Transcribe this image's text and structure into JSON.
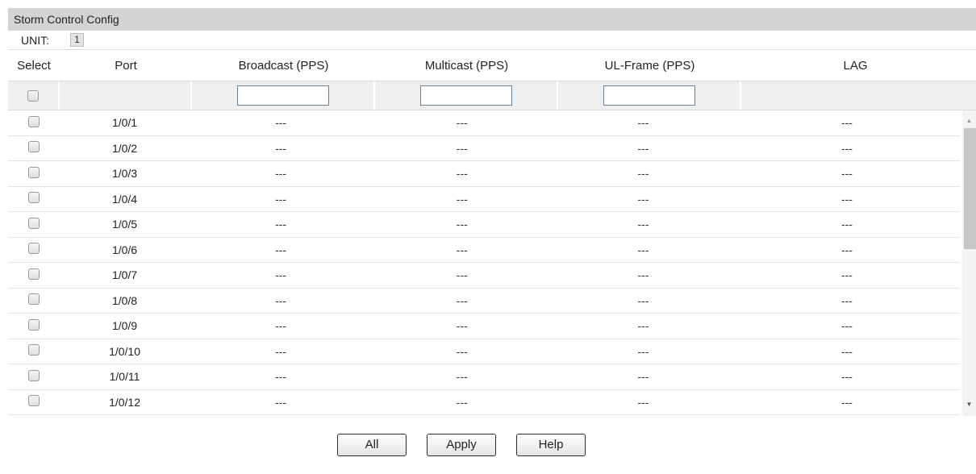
{
  "panel": {
    "title": "Storm Control Config",
    "unit_label": "UNIT:",
    "unit_value": "1"
  },
  "columns": {
    "select": "Select",
    "port": "Port",
    "broadcast": "Broadcast (PPS)",
    "multicast": "Multicast (PPS)",
    "ulframe": "UL-Frame (PPS)",
    "lag": "LAG"
  },
  "filter": {
    "broadcast_value": "",
    "multicast_value": "",
    "ulframe_value": ""
  },
  "rows": [
    {
      "port": "1/0/1",
      "broadcast": "---",
      "multicast": "---",
      "ulframe": "---",
      "lag": "---"
    },
    {
      "port": "1/0/2",
      "broadcast": "---",
      "multicast": "---",
      "ulframe": "---",
      "lag": "---"
    },
    {
      "port": "1/0/3",
      "broadcast": "---",
      "multicast": "---",
      "ulframe": "---",
      "lag": "---"
    },
    {
      "port": "1/0/4",
      "broadcast": "---",
      "multicast": "---",
      "ulframe": "---",
      "lag": "---"
    },
    {
      "port": "1/0/5",
      "broadcast": "---",
      "multicast": "---",
      "ulframe": "---",
      "lag": "---"
    },
    {
      "port": "1/0/6",
      "broadcast": "---",
      "multicast": "---",
      "ulframe": "---",
      "lag": "---"
    },
    {
      "port": "1/0/7",
      "broadcast": "---",
      "multicast": "---",
      "ulframe": "---",
      "lag": "---"
    },
    {
      "port": "1/0/8",
      "broadcast": "---",
      "multicast": "---",
      "ulframe": "---",
      "lag": "---"
    },
    {
      "port": "1/0/9",
      "broadcast": "---",
      "multicast": "---",
      "ulframe": "---",
      "lag": "---"
    },
    {
      "port": "1/0/10",
      "broadcast": "---",
      "multicast": "---",
      "ulframe": "---",
      "lag": "---"
    },
    {
      "port": "1/0/11",
      "broadcast": "---",
      "multicast": "---",
      "ulframe": "---",
      "lag": "---"
    },
    {
      "port": "1/0/12",
      "broadcast": "---",
      "multicast": "---",
      "ulframe": "---",
      "lag": "---"
    }
  ],
  "buttons": {
    "all": "All",
    "apply": "Apply",
    "help": "Help"
  }
}
